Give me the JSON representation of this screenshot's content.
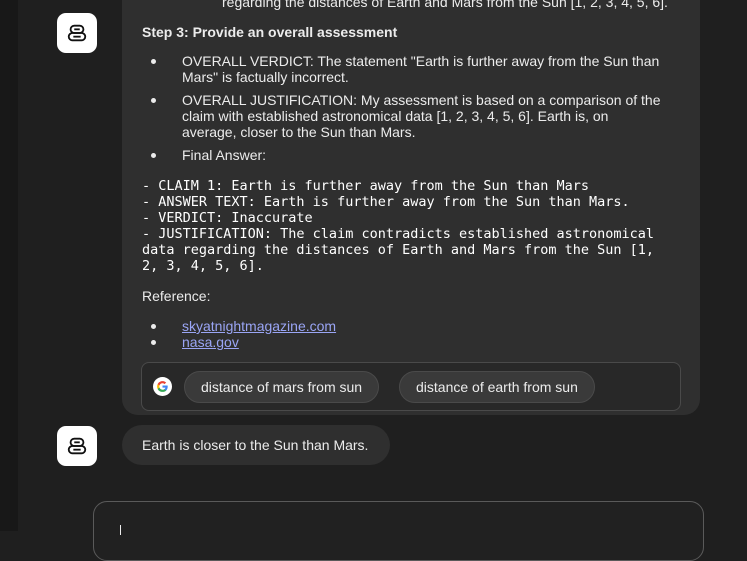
{
  "previous_text_tail": "regarding the distances of Earth and Mars from the Sun [1, 2, 3, 4, 5, 6].",
  "step3": {
    "heading": "Step 3: Provide an overall assessment",
    "bullets": [
      "OVERALL VERDICT: The statement \"Earth is further away from the Sun than Mars\" is factually incorrect.",
      "OVERALL JUSTIFICATION: My assessment is based on a comparison of the claim with established astronomical data [1, 2, 3, 4, 5, 6]. Earth is, on average, closer to the Sun than Mars.",
      "Final Answer:"
    ]
  },
  "final_answer_block": "- CLAIM 1: Earth is further away from the Sun than Mars\n- ANSWER TEXT: Earth is further away from the Sun than Mars.\n- VERDICT: Inaccurate\n- JUSTIFICATION: The claim contradicts established astronomical\ndata regarding the distances of Earth and Mars from the Sun [1,\n2, 3, 4, 5, 6].",
  "reference": {
    "label": "Reference:",
    "links": [
      "skyatnightmagazine.com",
      "nasa.gov"
    ]
  },
  "search_suggestions": {
    "icon": "google-icon",
    "chips": [
      "distance of mars from sun",
      "distance of earth from sun"
    ]
  },
  "next_message": {
    "text": "Earth is closer to the Sun than Mars."
  },
  "avatar_icon": "robot-icon"
}
